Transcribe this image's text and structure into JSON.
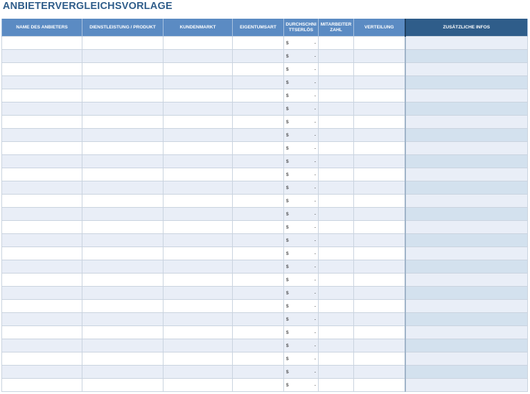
{
  "title": "ANBIETERVERGLEICHSVORLAGE",
  "columns": [
    {
      "key": "name",
      "label": "NAME DES ANBIETERS"
    },
    {
      "key": "service",
      "label": "DIENSTLEISTUNG / PRODUKT"
    },
    {
      "key": "market",
      "label": "KUNDENMARKT"
    },
    {
      "key": "ownership",
      "label": "EIGENTUMSART"
    },
    {
      "key": "revenue",
      "label": "DURCHSCHNITTSERLÖS"
    },
    {
      "key": "employees",
      "label": "MITARBEITERZAHL"
    },
    {
      "key": "distribution",
      "label": "VERTEILUNG"
    },
    {
      "key": "extra",
      "label": "ZUSÄTZLICHE INFOS"
    }
  ],
  "currency_symbol": "$",
  "empty_value": "-",
  "row_count": 27,
  "colors": {
    "title": "#2f5d8a",
    "header": "#5b8bc3",
    "header_dark": "#2f5d8a",
    "row_alt": "#e9eef7",
    "extra_alt": "#d3e1ee"
  }
}
